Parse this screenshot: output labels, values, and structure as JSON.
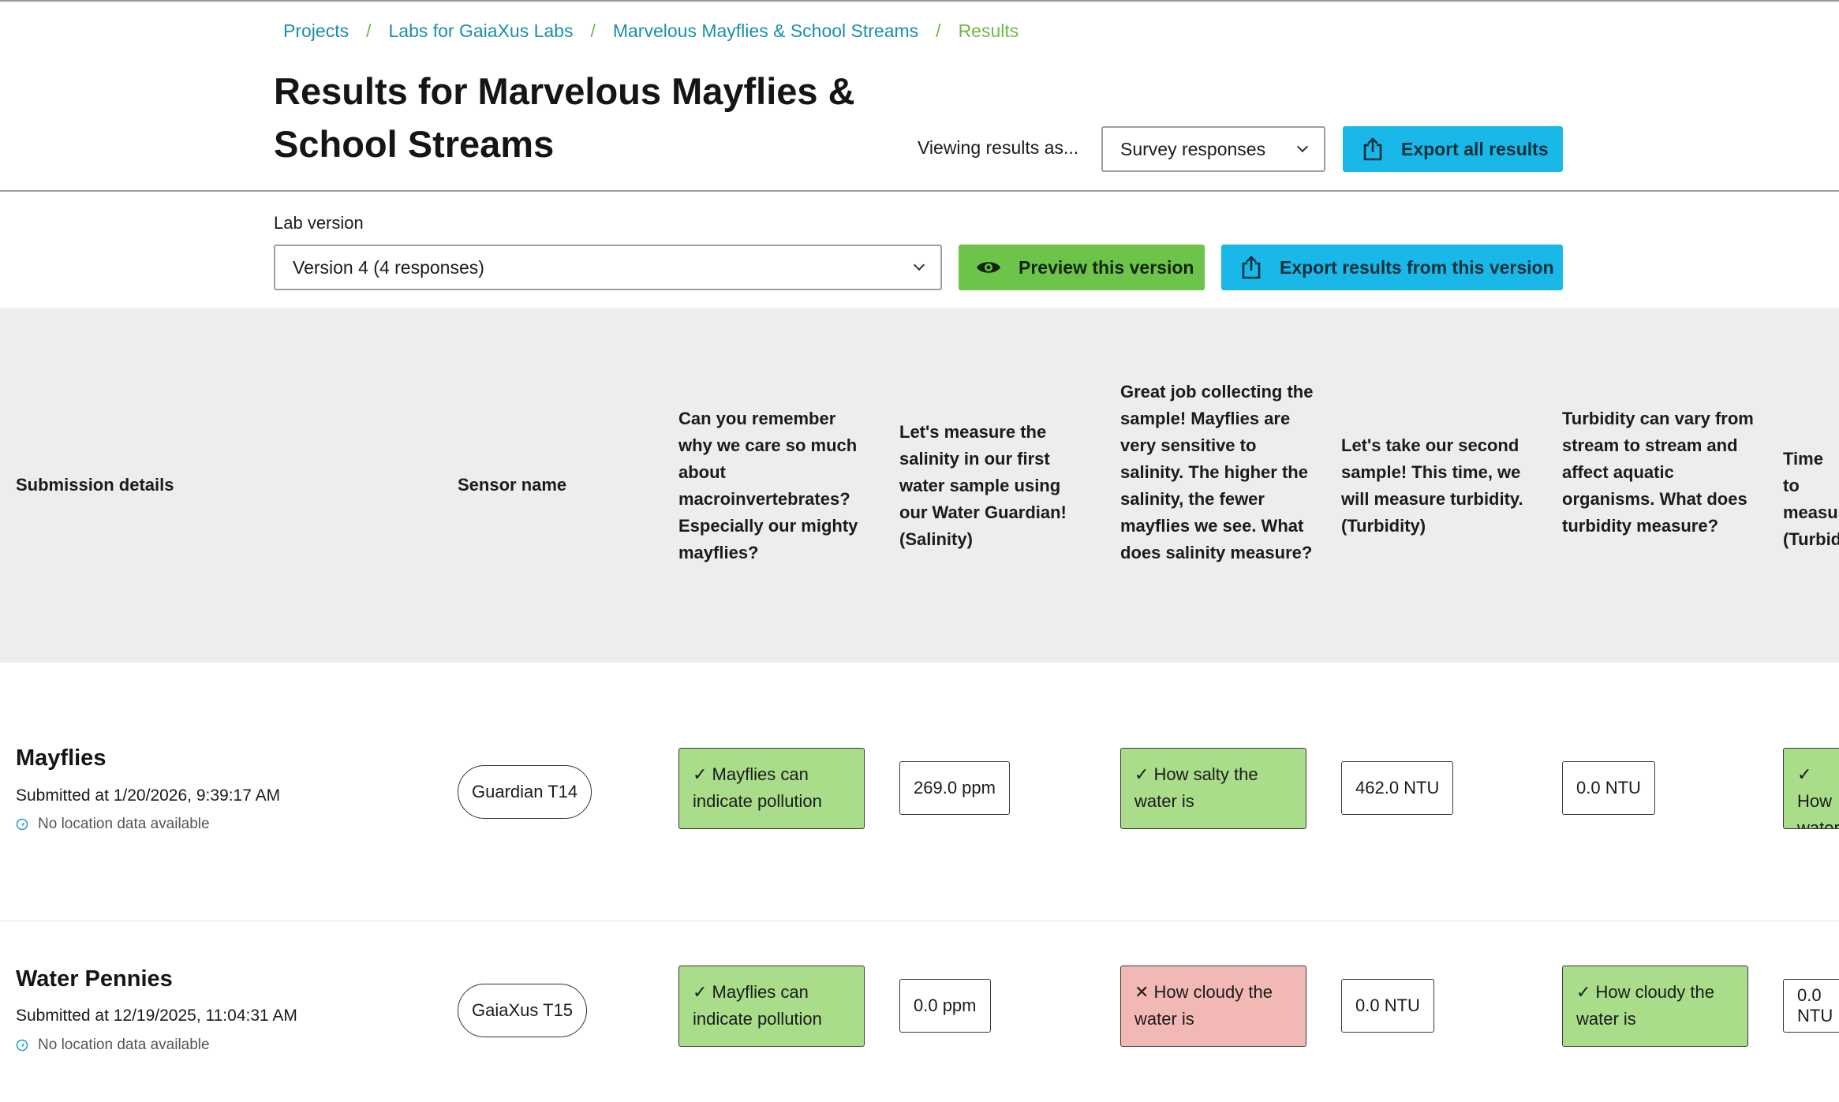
{
  "breadcrumb": {
    "items": [
      "Projects",
      "Labs for GaiaXus Labs",
      "Marvelous Mayflies & School Streams",
      "Results"
    ],
    "separator": "/"
  },
  "page": {
    "title": "Results for Marvelous Mayflies & School Streams"
  },
  "viewing": {
    "label": "Viewing results as...",
    "selected": "Survey responses"
  },
  "export_all_label": "Export all results",
  "lab_version": {
    "label": "Lab version",
    "selected": "Version 4 (4 responses)",
    "preview_label": "Preview this version",
    "export_label": "Export results from this version"
  },
  "table": {
    "headers": {
      "submission": "Submission details",
      "sensor": "Sensor name",
      "q1": "Can you remember why we care so much about macroinvertebrates? Especially our mighty mayflies?",
      "q2": "Let's measure the salinity in our first water sample using our Water Guardian! (Salinity)",
      "q3": "Great job collecting the sample! Mayflies are very sensitive to salinity. The higher the salinity, the fewer mayflies we see. What does salinity measure?",
      "q4": "Let's take our second sample! This time, we will measure turbidity. (Turbidity)",
      "q5": "Turbidity can vary from stream to stream and affect aquatic organisms. What does turbidity measure?",
      "q6": "Time to measure (Turbidity)"
    },
    "rows": [
      {
        "name": "Mayflies",
        "submitted": "Submitted at 1/20/2026, 9:39:17 AM",
        "location": "No location data available",
        "sensor": "Guardian T14",
        "q1": "✓ Mayflies can indicate pollution",
        "q2": "269.0 ppm",
        "q3": "✓ How salty the water is",
        "q4": "462.0 NTU",
        "q5": "0.0 NTU",
        "q6": "✓ How water"
      },
      {
        "name": "Water Pennies",
        "submitted": "Submitted at 12/19/2025, 11:04:31 AM",
        "location": "No location data available",
        "sensor": "GaiaXus T15",
        "q1": "✓ Mayflies can indicate pollution",
        "q2": "0.0 ppm",
        "q3": "✕ How cloudy the water is",
        "q4": "0.0 NTU",
        "q5": "✓ How cloudy the water is",
        "q6": "0.0 NTU"
      }
    ]
  },
  "colors": {
    "link": "#1a8fa6",
    "breadcrumb_current": "#6fb84a",
    "primary_button": "#1ab8e8",
    "preview_button": "#6cc44a",
    "correct_answer": "#a9dd8a",
    "wrong_answer": "#f2b8b6",
    "table_header_bg": "#eceeed"
  },
  "icons": {
    "export": "share-upload-icon",
    "preview": "eye-icon",
    "location": "location-icon",
    "dropdown": "chevron-down-icon"
  }
}
